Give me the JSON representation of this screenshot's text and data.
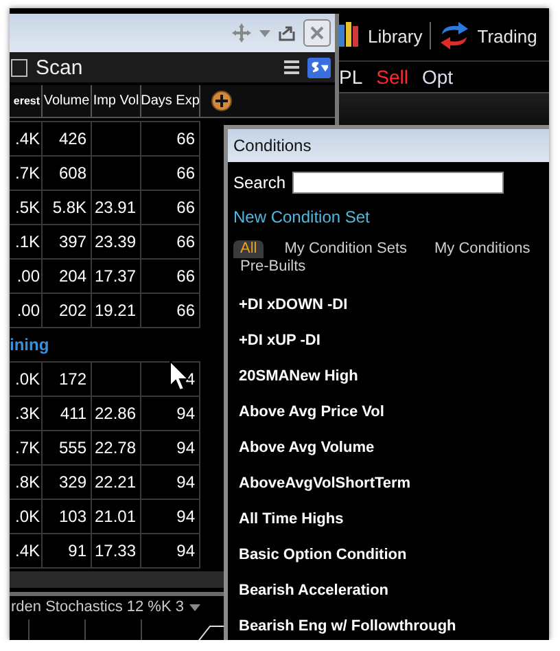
{
  "app_toolbar": [
    {
      "label": "Library",
      "kind": "library"
    },
    {
      "label": "Trading",
      "kind": "trading"
    }
  ],
  "order_bar": [
    {
      "label": "PL",
      "color": "#e8e8e8"
    },
    {
      "label": "Sell",
      "color": "#ff2a2a"
    },
    {
      "label": "Opt",
      "color": "#dcdcf0"
    }
  ],
  "scan_window": {
    "header": {
      "label": "Scan",
      "checked": false
    },
    "columns": [
      "erest",
      "Volume",
      "Imp Vol",
      "Days Exp"
    ],
    "groups": [
      {
        "rows": [
          [
            ".4K",
            "426",
            null,
            "66"
          ],
          [
            ".7K",
            "608",
            null,
            "66"
          ],
          [
            ".5K",
            "5.8K",
            "23.91",
            "66"
          ],
          [
            ".1K",
            "397",
            "23.39",
            "66"
          ],
          [
            ".00",
            "204",
            "17.37",
            "66"
          ],
          [
            ".00",
            "202",
            "19.21",
            "66"
          ]
        ]
      },
      {
        "title": "ining",
        "rows": [
          [
            ".0K",
            "172",
            null,
            "4"
          ],
          [
            ".3K",
            "411",
            "22.86",
            "94"
          ],
          [
            ".7K",
            "555",
            "22.78",
            "94"
          ],
          [
            ".8K",
            "329",
            "22.21",
            "94"
          ],
          [
            ".0K",
            "103",
            "21.01",
            "94"
          ],
          [
            ".4K",
            "91",
            "17.33",
            "94"
          ]
        ]
      }
    ],
    "study": {
      "label": "rden Stochastics 12 %K 3"
    }
  },
  "conditions_window": {
    "title": "Conditions",
    "search": {
      "label": "Search"
    },
    "new_link": "New Condition Set",
    "tabs": [
      {
        "label": "All",
        "selected": true
      },
      {
        "label": "My Condition Sets",
        "selected": false
      },
      {
        "label": "My Conditions",
        "selected": false
      },
      {
        "label": "Pre-Builts",
        "selected": false
      }
    ],
    "items": [
      "+DI xDOWN -DI",
      "+DI xUP -DI",
      "20SMANew High",
      "Above Avg Price Vol",
      "Above Avg Volume",
      "AboveAvgVolShortTerm",
      "All Time Highs",
      "Basic Option Condition",
      "Bearish Acceleration",
      "Bearish Eng w/ Followthrough"
    ]
  }
}
